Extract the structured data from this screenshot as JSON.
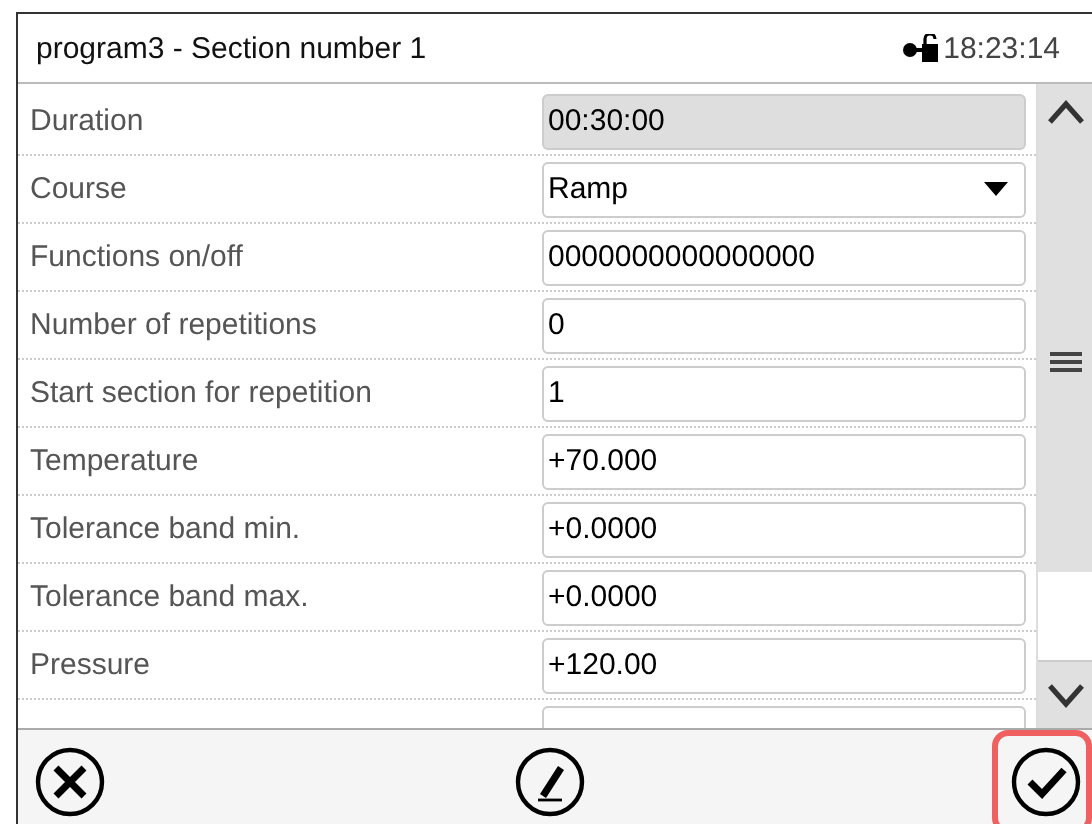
{
  "window": {
    "title": "program3 - Section number 1",
    "time": "18:23:14"
  },
  "rows": [
    {
      "label": "Duration",
      "kind": "readonly",
      "value": "00:30:00"
    },
    {
      "label": "Course",
      "kind": "dropdown",
      "value": "Ramp"
    },
    {
      "label": "Functions on/off",
      "kind": "text",
      "value": "0000000000000000"
    },
    {
      "label": "Number of repetitions",
      "kind": "text",
      "value": "0"
    },
    {
      "label": "Start section for repetition",
      "kind": "text",
      "value": "1"
    },
    {
      "label": "Temperature",
      "kind": "text",
      "value": "+70.000"
    },
    {
      "label": "Tolerance band min.",
      "kind": "text",
      "value": "+0.0000"
    },
    {
      "label": "Tolerance band max.",
      "kind": "text",
      "value": "+0.0000"
    },
    {
      "label": "Pressure",
      "kind": "text",
      "value": "+120.00"
    }
  ],
  "footer": {
    "confirm_highlighted": true
  }
}
